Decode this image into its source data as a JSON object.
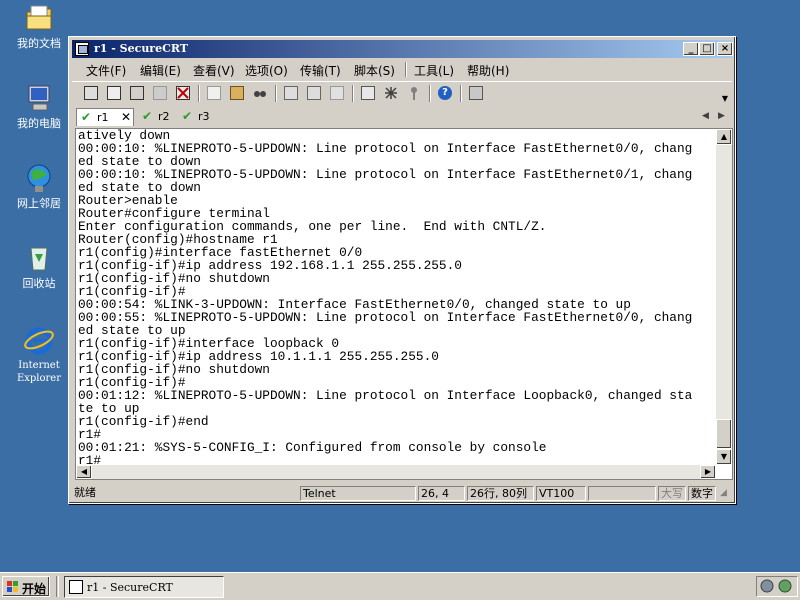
{
  "desktop": {
    "icons": [
      {
        "label": "我的文档"
      },
      {
        "label": "我的电脑"
      },
      {
        "label": "网上邻居"
      },
      {
        "label": "回收站"
      },
      {
        "label": "Internet Explorer"
      }
    ]
  },
  "window": {
    "title": "r1 - SecureCRT",
    "menu": [
      "文件(F)",
      "编辑(E)",
      "查看(V)",
      "选项(O)",
      "传输(T)",
      "脚本(S)",
      "工具(L)",
      "帮助(H)"
    ],
    "tabs": [
      {
        "label": "r1",
        "active": true
      },
      {
        "label": "r2",
        "active": false
      },
      {
        "label": "r3",
        "active": false
      }
    ],
    "terminal_lines": [
      "atively down",
      "00:00:10: %LINEPROTO-5-UPDOWN: Line protocol on Interface FastEthernet0/0, chang",
      "ed state to down",
      "00:00:10: %LINEPROTO-5-UPDOWN: Line protocol on Interface FastEthernet0/1, chang",
      "ed state to down",
      "Router>enable",
      "Router#configure terminal",
      "Enter configuration commands, one per line.  End with CNTL/Z.",
      "Router(config)#hostname r1",
      "r1(config)#interface fastEthernet 0/0",
      "r1(config-if)#ip address 192.168.1.1 255.255.255.0",
      "r1(config-if)#no shutdown",
      "r1(config-if)#",
      "00:00:54: %LINK-3-UPDOWN: Interface FastEthernet0/0, changed state to up",
      "00:00:55: %LINEPROTO-5-UPDOWN: Line protocol on Interface FastEthernet0/0, chang",
      "ed state to up",
      "r1(config-if)#interface loopback 0",
      "r1(config-if)#ip address 10.1.1.1 255.255.255.0",
      "r1(config-if)#no shutdown",
      "r1(config-if)#",
      "00:01:12: %LINEPROTO-5-UPDOWN: Line protocol on Interface Loopback0, changed sta",
      "te to up",
      "r1(config-if)#end",
      "r1#",
      "00:01:21: %SYS-5-CONFIG_I: Configured from console by console",
      "r1#"
    ],
    "status": {
      "ready": "就绪",
      "protocol": "Telnet",
      "cursor": "26,  4",
      "size": "26行, 80列",
      "emulation": "VT100",
      "caps": "大写",
      "num": "数字"
    }
  },
  "taskbar": {
    "start_label": "开始",
    "task_title": "r1 - SecureCRT"
  },
  "colors": {
    "desktop": "#3a6ea5",
    "titlebar_start": "#0a246a",
    "titlebar_end": "#a6caf0",
    "tab_check": "#2a9a2a"
  }
}
